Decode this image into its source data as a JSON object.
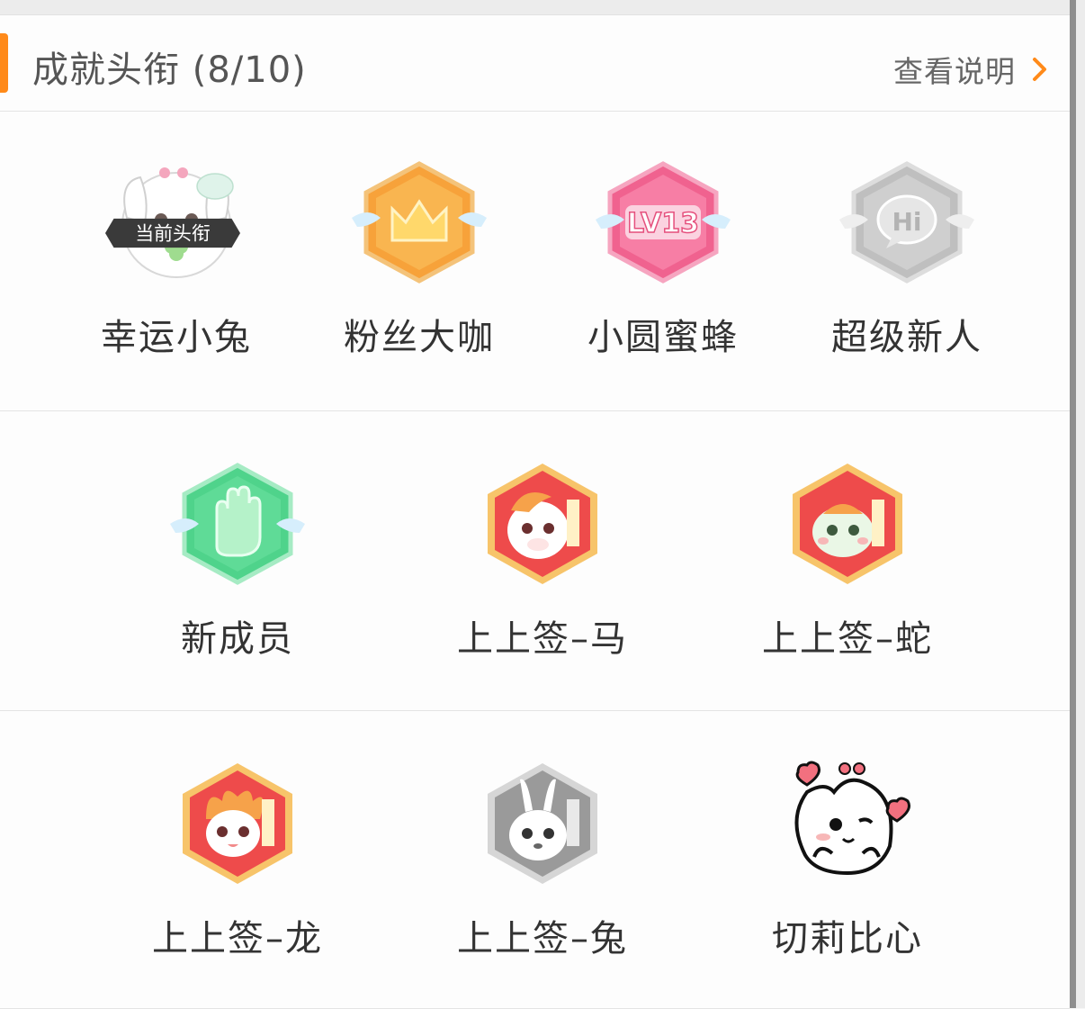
{
  "header": {
    "title": "成就头衔 (8/10)",
    "view_label": "查看说明",
    "accent_color": "#ff8a1a"
  },
  "badges": [
    {
      "label": "幸运小兔",
      "icon": "lucky-bunny-icon",
      "current_tag": "当前头衔"
    },
    {
      "label": "粉丝大咖",
      "icon": "crown-hexagon-icon"
    },
    {
      "label": "小圆蜜蜂",
      "icon": "lv13-hexagon-icon",
      "badge_text": "LV13"
    },
    {
      "label": "超级新人",
      "icon": "hi-hexagon-icon",
      "badge_text": "Hi"
    },
    {
      "label": "新成员",
      "icon": "waving-hand-hexagon-icon"
    },
    {
      "label": "上上签–马",
      "icon": "horse-hexagon-icon"
    },
    {
      "label": "上上签–蛇",
      "icon": "snake-hexagon-icon"
    },
    {
      "label": "上上签–龙",
      "icon": "dragon-hexagon-icon"
    },
    {
      "label": "上上签–兔",
      "icon": "rabbit-hexagon-icon"
    },
    {
      "label": "切莉比心",
      "icon": "heart-bunny-icon"
    }
  ]
}
